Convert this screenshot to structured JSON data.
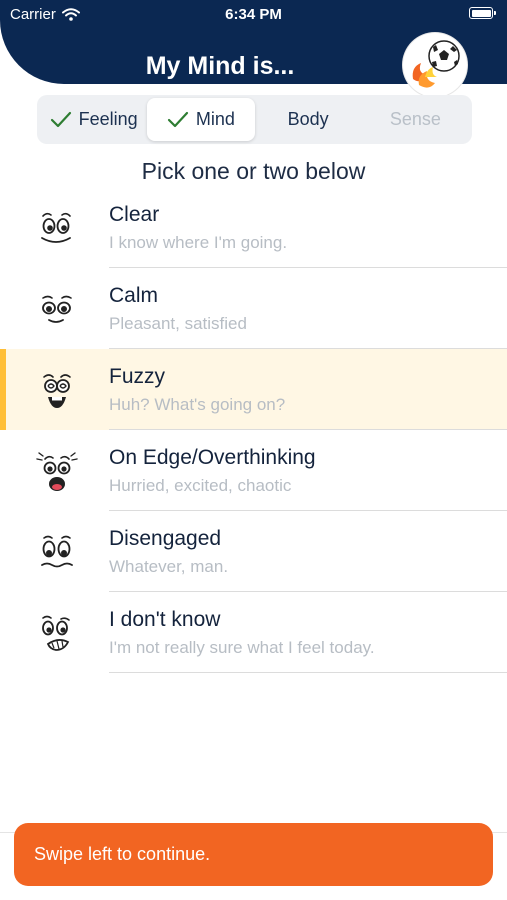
{
  "status_bar": {
    "carrier": "Carrier",
    "time": "6:34 PM"
  },
  "header": {
    "title": "My Mind is..."
  },
  "tabs": [
    {
      "label": "Feeling",
      "checked": true,
      "state": "normal"
    },
    {
      "label": "Mind",
      "checked": true,
      "state": "active"
    },
    {
      "label": "Body",
      "checked": false,
      "state": "normal"
    },
    {
      "label": "Sense",
      "checked": false,
      "state": "disabled"
    }
  ],
  "prompt": "Pick one or two below",
  "options": [
    {
      "label": "Clear",
      "description": "I know where I'm going.",
      "icon": "clear-face-icon",
      "selected": false
    },
    {
      "label": "Calm",
      "description": "Pleasant, satisfied",
      "icon": "calm-face-icon",
      "selected": false
    },
    {
      "label": "Fuzzy",
      "description": "Huh? What's going on?",
      "icon": "fuzzy-face-icon",
      "selected": true
    },
    {
      "label": "On Edge/Overthinking",
      "description": "Hurried, excited, chaotic",
      "icon": "on-edge-face-icon",
      "selected": false
    },
    {
      "label": "Disengaged",
      "description": "Whatever, man.",
      "icon": "disengaged-face-icon",
      "selected": false
    },
    {
      "label": "I don't know",
      "description": "I'm not really sure what I feel today.",
      "icon": "unsure-face-icon",
      "selected": false
    }
  ],
  "footer": {
    "toast": "Swipe left to continue."
  },
  "colors": {
    "header": "#0b2852",
    "accent": "#f26522",
    "selected_row": "#fff7e4",
    "selected_bar": "#ffbf38",
    "check": "#2e7d32"
  }
}
